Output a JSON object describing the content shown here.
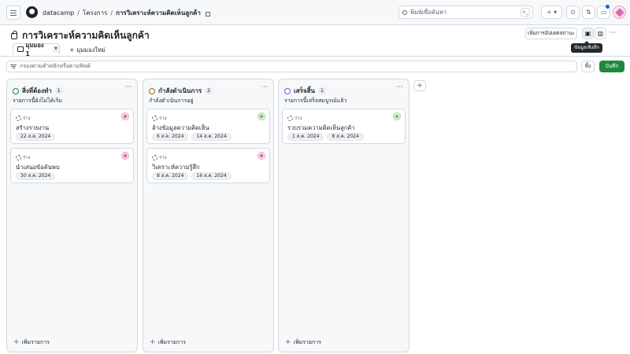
{
  "header": {
    "breadcrumb": [
      "datacamp",
      "โครงการ",
      "การวิเคราะห์ความคิดเห็นลูกค้า"
    ],
    "breadcrumb_sep": "/",
    "search_placeholder": "พิมพ์เพื่อค้นหา",
    "search_shortcut": ">_",
    "plus_label": "+ ▾",
    "icons": [
      "menu-icon",
      "github-logo",
      "lock-icon",
      "search-icon",
      "command-palette-icon",
      "plus-icon",
      "issues-icon",
      "pull-requests-icon",
      "inbox-icon",
      "avatar"
    ]
  },
  "project": {
    "title": "การวิเคราะห์ความคิดเห็นลูกค้า",
    "status_update_label": "เพิ่มการอัปเดตสถานะ",
    "more_label": "···",
    "tooltip": "ข้อมูลเชิงลึก",
    "insights_icon": "▣",
    "layout_icon": "▥"
  },
  "views": {
    "active_tab": "มุมมอง 1",
    "new_view": "มุมมองใหม่",
    "new_view_icon": "+"
  },
  "filter": {
    "placeholder": "กรองตามคำหลักหรือตามฟิลด์",
    "discard_label": "ทิ้ง",
    "save_label": "บันทึก"
  },
  "board": {
    "add_item_label": "เพิ่มรายการ",
    "add_column_label": "+",
    "columns": [
      {
        "name": "สิ่งที่ต้องทำ",
        "count": "1",
        "description": "รายการนี้ยังไม่ได้เริ่ม",
        "status_color": "#1a7f37",
        "cards": [
          {
            "type": "ร่าง",
            "title": "สร้างรายงาน",
            "dates": [
              "22 ส.ค. 2024"
            ],
            "assignee": "pink"
          },
          {
            "type": "ร่าง",
            "title": "นำเสนอข้อค้นพบ",
            "dates": [
              "30 ส.ค. 2024"
            ],
            "assignee": "pink"
          }
        ]
      },
      {
        "name": "กำลังดำเนินการ",
        "count": "2",
        "description": "กำลังดำเนินการอยู่",
        "status_color": "#9a6700",
        "cards": [
          {
            "type": "ร่าง",
            "title": "ล้างข้อมูลความคิดเห็น",
            "dates": [
              "6 ส.ค. 2024",
              "14 ส.ค. 2024"
            ],
            "assignee": "green"
          },
          {
            "type": "ร่าง",
            "title": "วิเคราะห์ความรู้สึก",
            "dates": [
              "8 ส.ค. 2024",
              "16 ส.ค. 2024"
            ],
            "assignee": "pink"
          }
        ]
      },
      {
        "name": "เสร็จสิ้น",
        "count": "1",
        "description": "รายการนี้เสร็จสมบูรณ์แล้ว",
        "status_color": "#8250df",
        "cards": [
          {
            "type": "ร่าง",
            "title": "รวบรวมความคิดเห็นลูกค้า",
            "dates": [
              "1 ส.ค. 2024",
              "8 ส.ค. 2024"
            ],
            "assignee": "green"
          }
        ]
      }
    ]
  }
}
